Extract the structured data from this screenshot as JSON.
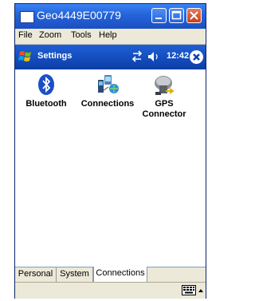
{
  "window": {
    "title": "Geo4449E00779"
  },
  "menu": {
    "items": [
      "File",
      "Zoom",
      "Tools",
      "Help"
    ]
  },
  "nav": {
    "title": "Settings",
    "time": "12:42"
  },
  "apps": [
    {
      "label_line1": "Bluetooth",
      "label_line2": "",
      "icon": "bluetooth-icon"
    },
    {
      "label_line1": "Connections",
      "label_line2": "",
      "icon": "connections-icon"
    },
    {
      "label_line1": "GPS",
      "label_line2": "Connector",
      "icon": "gps-connector-icon"
    }
  ],
  "tabs": [
    {
      "label": "Personal",
      "active": false
    },
    {
      "label": "System",
      "active": false
    },
    {
      "label": "Connections",
      "active": true
    }
  ],
  "colors": {
    "titlebar": "#2463d8",
    "navbar": "#1e5fd6",
    "menubar": "#ece9d8"
  }
}
